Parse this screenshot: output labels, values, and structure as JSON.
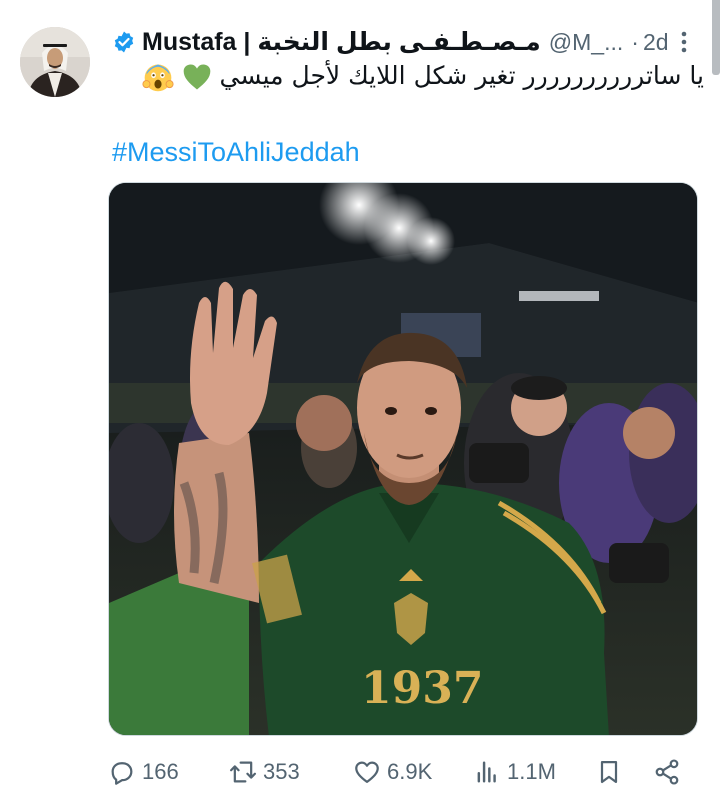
{
  "tweet": {
    "display_name": "Mustafa | مـصـطـفـى بطل النخبة",
    "handle": "@M_...",
    "separator": "·",
    "time": "2d",
    "text": "يا ساترررررررررر تغير شكل اللايك لأجل ميسي",
    "emojis": [
      "green-heart",
      "screaming-face"
    ],
    "hashtag": "#MessiToAhliJeddah"
  },
  "image": {
    "jersey_number": "1937"
  },
  "actions": {
    "replies": "166",
    "retweets": "353",
    "likes": "6.9K",
    "views": "1.1M"
  },
  "colors": {
    "link": "#1d9bf0",
    "muted": "#536471",
    "verified": "#1d9bf0",
    "emoji_heart": "#78b159",
    "jersey_green": "#1d4a2a",
    "jersey_gold": "#d4a84a"
  }
}
